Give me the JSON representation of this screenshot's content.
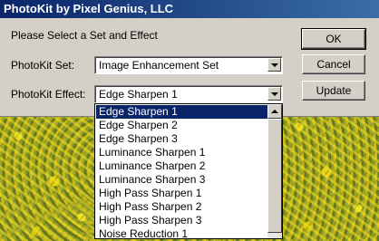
{
  "window": {
    "title": "PhotoKit by Pixel Genius, LLC"
  },
  "prompt": "Please Select a Set and Effect",
  "set": {
    "label": "PhotoKit Set:",
    "value": "Image Enhancement Set"
  },
  "effect": {
    "label": "PhotoKit Effect:",
    "value": "Edge Sharpen 1",
    "options": [
      "Edge Sharpen 1",
      "Edge Sharpen 2",
      "Edge Sharpen 3",
      "Luminance Sharpen 1",
      "Luminance Sharpen 2",
      "Luminance Sharpen 3",
      "High Pass Sharpen 1",
      "High Pass Sharpen 2",
      "High Pass Sharpen 3",
      "Noise Reduction 1"
    ],
    "selected_index": 0
  },
  "buttons": {
    "ok": "OK",
    "cancel": "Cancel",
    "update": "Update"
  },
  "icons": {
    "combo_arrow": "chevron-down-icon",
    "scroll_up": "scroll-up-icon"
  },
  "colors": {
    "titlebar": "#0a246a",
    "dialog_bg": "#d4d0c8",
    "selection": "#0a246a"
  }
}
